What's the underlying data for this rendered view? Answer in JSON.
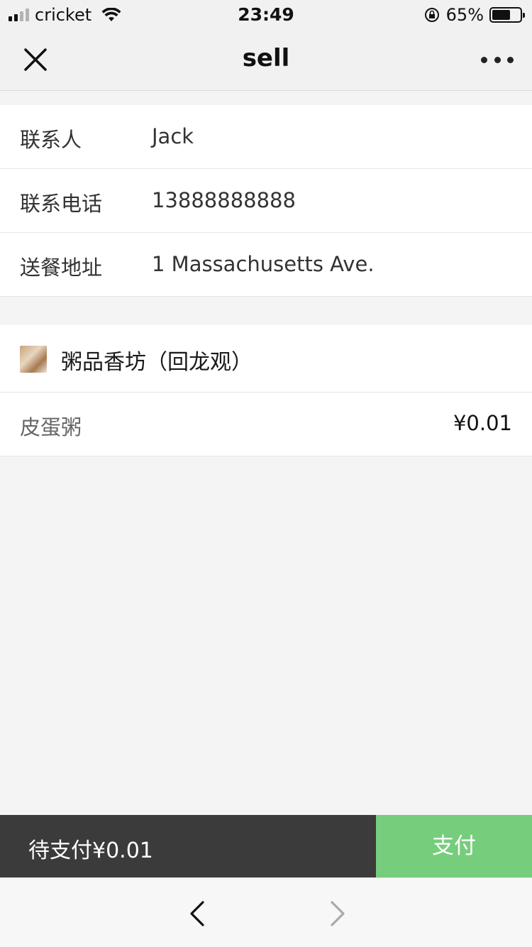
{
  "status_bar": {
    "carrier": "cricket",
    "time": "23:49",
    "battery_text": "65%",
    "battery_level": 0.65,
    "signal_bars": 2,
    "icons": [
      "signal-icon",
      "wifi-icon",
      "orientation-lock-icon",
      "battery-icon"
    ]
  },
  "nav": {
    "title": "sell",
    "close_icon": "close-icon",
    "more_icon": "more-icon"
  },
  "contact": {
    "rows": [
      {
        "label": "联系人",
        "value": "Jack"
      },
      {
        "label": "联系电话",
        "value": "13888888888"
      },
      {
        "label": "送餐地址",
        "value": "1 Massachusetts Ave."
      }
    ]
  },
  "shop": {
    "name": "粥品香坊（回龙观）",
    "logo_icon": "shop-logo-icon",
    "items": [
      {
        "name": "皮蛋粥",
        "price": "¥0.01"
      }
    ]
  },
  "pay_bar": {
    "total_text": "待支付¥0.01",
    "pay_label": "支付"
  },
  "browser_bar": {
    "back_icon": "chevron-left-icon",
    "forward_icon": "chevron-right-icon"
  },
  "colors": {
    "pay_green": "#76cd7c",
    "pay_dark": "#3b3b3b",
    "background": "#f4f4f4"
  }
}
